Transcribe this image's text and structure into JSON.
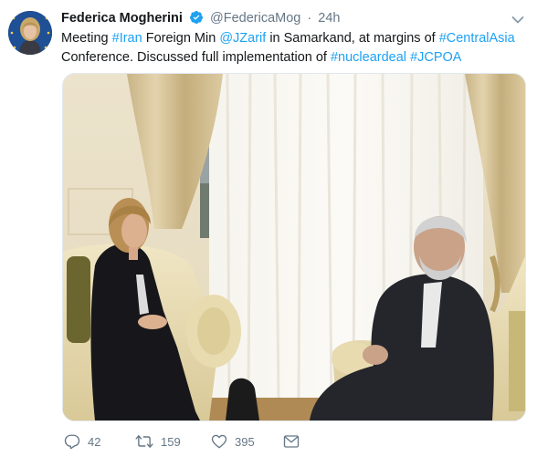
{
  "tweet": {
    "author_name": "Federica Mogherini",
    "author_handle": "@FedericaMog",
    "separator": "·",
    "timestamp": "24h",
    "text_segments": [
      {
        "text": "Meeting ",
        "link": false
      },
      {
        "text": "#Iran",
        "link": true
      },
      {
        "text": " Foreign Min ",
        "link": false
      },
      {
        "text": "@JZarif",
        "link": true
      },
      {
        "text": " in Samarkand, at margins of ",
        "link": false
      },
      {
        "text": "#CentralAsia",
        "link": true
      },
      {
        "text": " Conference. Discussed full implementation of ",
        "link": false
      },
      {
        "text": "#nucleardeal",
        "link": true
      },
      {
        "text": " ",
        "link": false
      },
      {
        "text": "#JCPOA",
        "link": true
      }
    ],
    "photo_icon": "photo-of-meeting",
    "actions": {
      "reply_count": "42",
      "retweet_count": "159",
      "like_count": "395",
      "reply_icon": "reply-icon",
      "retweet_icon": "retweet-icon",
      "like_icon": "heart-icon",
      "message_icon": "envelope-icon"
    }
  },
  "colors": {
    "link": "#1da1f2",
    "muted": "#657786",
    "text": "#14171a",
    "verified": "#1da1f2"
  }
}
